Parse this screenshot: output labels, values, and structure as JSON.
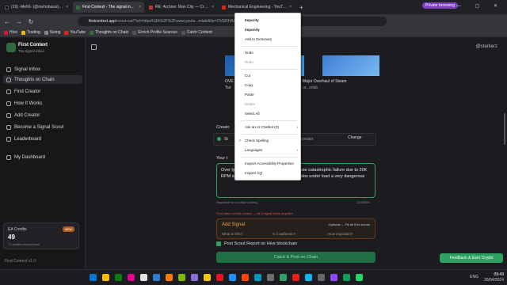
{
  "browser": {
    "tabs": [
      {
        "label": "(16) -Meh0- (@mehobassi) / X",
        "color": "#111111"
      },
      {
        "label": "First Context - The signal inbox",
        "color": "#2f6b3d",
        "active": true
      },
      {
        "label": "RE: Archive: Man City — Crest",
        "color": "#c0392b"
      },
      {
        "label": "Mechanical Engineering - YouTube",
        "color": "#e62117"
      }
    ],
    "new_tab": "+",
    "profile": "Private browsing",
    "window_controls": "— ▢ ✕",
    "url_host": "firstcontext.app",
    "url_rest": "/scout-cat/?url=https%3A%2F%2Fwww.youtu...mlab/title=OVERHAUL%3A Inspection%3C1%...",
    "bookmarks": [
      {
        "label": "Hive",
        "color": "#e31337"
      },
      {
        "label": "Trading",
        "color": "#f0b90b"
      },
      {
        "label": "Swing",
        "color": "#888888"
      },
      {
        "label": "YouTube",
        "color": "#e62117"
      },
      {
        "label": "Thoughts on Chain",
        "color": "#2f6b3d"
      },
      {
        "label": "Enrich Profile Sources",
        "color": "#555555"
      },
      {
        "label": "Catch Content",
        "color": "#555555"
      }
    ]
  },
  "sidebar": {
    "brand_title": "First Context",
    "brand_sub": "The signal inbox",
    "items": [
      {
        "label": "Signal Inbox"
      },
      {
        "label": "Thoughts on Chain",
        "active": true
      },
      {
        "label": "Find Creator"
      },
      {
        "label": "How It Works"
      },
      {
        "label": "Add Creator"
      },
      {
        "label": "Become a Signal Scout"
      },
      {
        "label": "Leaderboard"
      },
      {
        "label": "My Dashboard"
      }
    ],
    "credits": {
      "label": "EA Credits",
      "value": "49",
      "sub": "71 credits earned total",
      "badge": "NEW"
    },
    "version": "First Context v1.0"
  },
  "main": {
    "user": "@starkerz",
    "card1_title": "OVE",
    "card1_line2": "Tur",
    "card2_title": "Major Overhaul of Steam",
    "card2_line2": "ur...mlab",
    "creator_label": "Creato",
    "creator_value": "St",
    "creator_placeholder": "creator",
    "change_label": "Change",
    "your_label": "Your t",
    "textarea_text": "Over                                          ly important, any single imbr                                          can cause catastrophic failure due to 20K RPM speeds being able to shatter the blades under load a very dangerous",
    "req_note": "Required for on-chain posting",
    "counter": "219/5000",
    "first_note": "First catch for this creator — all 5 signal fields required",
    "add_signal": "Add Signal",
    "optional": "Optional — Fill all 5 for bonus",
    "questions": [
      "What is this?",
      "Is it authentic?",
      "How important?"
    ],
    "hive_label": "Post Scout Report on Hive blockchain",
    "claim_button": "Catch & Post on Chain",
    "feedback_button": "Feedback & Earn Crypto"
  },
  "context_menu": {
    "items": [
      {
        "label": "Impurity",
        "bold": true
      },
      {
        "label": "impunity",
        "bold": true
      },
      {
        "label": "Add to Dictionary"
      },
      {
        "label": "Undo"
      },
      {
        "label": "Redo",
        "disabled": true
      },
      {
        "label": "Cut"
      },
      {
        "label": "Copy"
      },
      {
        "label": "Paste"
      },
      {
        "label": "Delete",
        "disabled": true
      },
      {
        "label": "Select All"
      },
      {
        "label": "Ask an AI Chatbot (Z)",
        "submenu": true
      },
      {
        "label": "Check Spelling",
        "checked": true
      },
      {
        "label": "Languages",
        "submenu": true
      },
      {
        "label": "Inspect Accessibility Properties"
      },
      {
        "label": "Inspect (Q)"
      }
    ]
  },
  "taskbar": {
    "icons": [
      "#0078d4",
      "#ffb900",
      "#0f7b0f",
      "#e3008c",
      "#e2e2e2",
      "#2d7dd2",
      "#ff7b00",
      "#7fba00",
      "#8c6cd9",
      "#f2c811",
      "#e81123",
      "#1e90ff",
      "#ff4500",
      "#0099bc",
      "#6e6e6e",
      "#2fa063",
      "#e62117",
      "#0db7ed",
      "#666666",
      "#9146ff",
      "#0f9d58",
      "#25d366"
    ],
    "tray": "ENG",
    "time": "09:49",
    "date": "30/04/2024"
  }
}
